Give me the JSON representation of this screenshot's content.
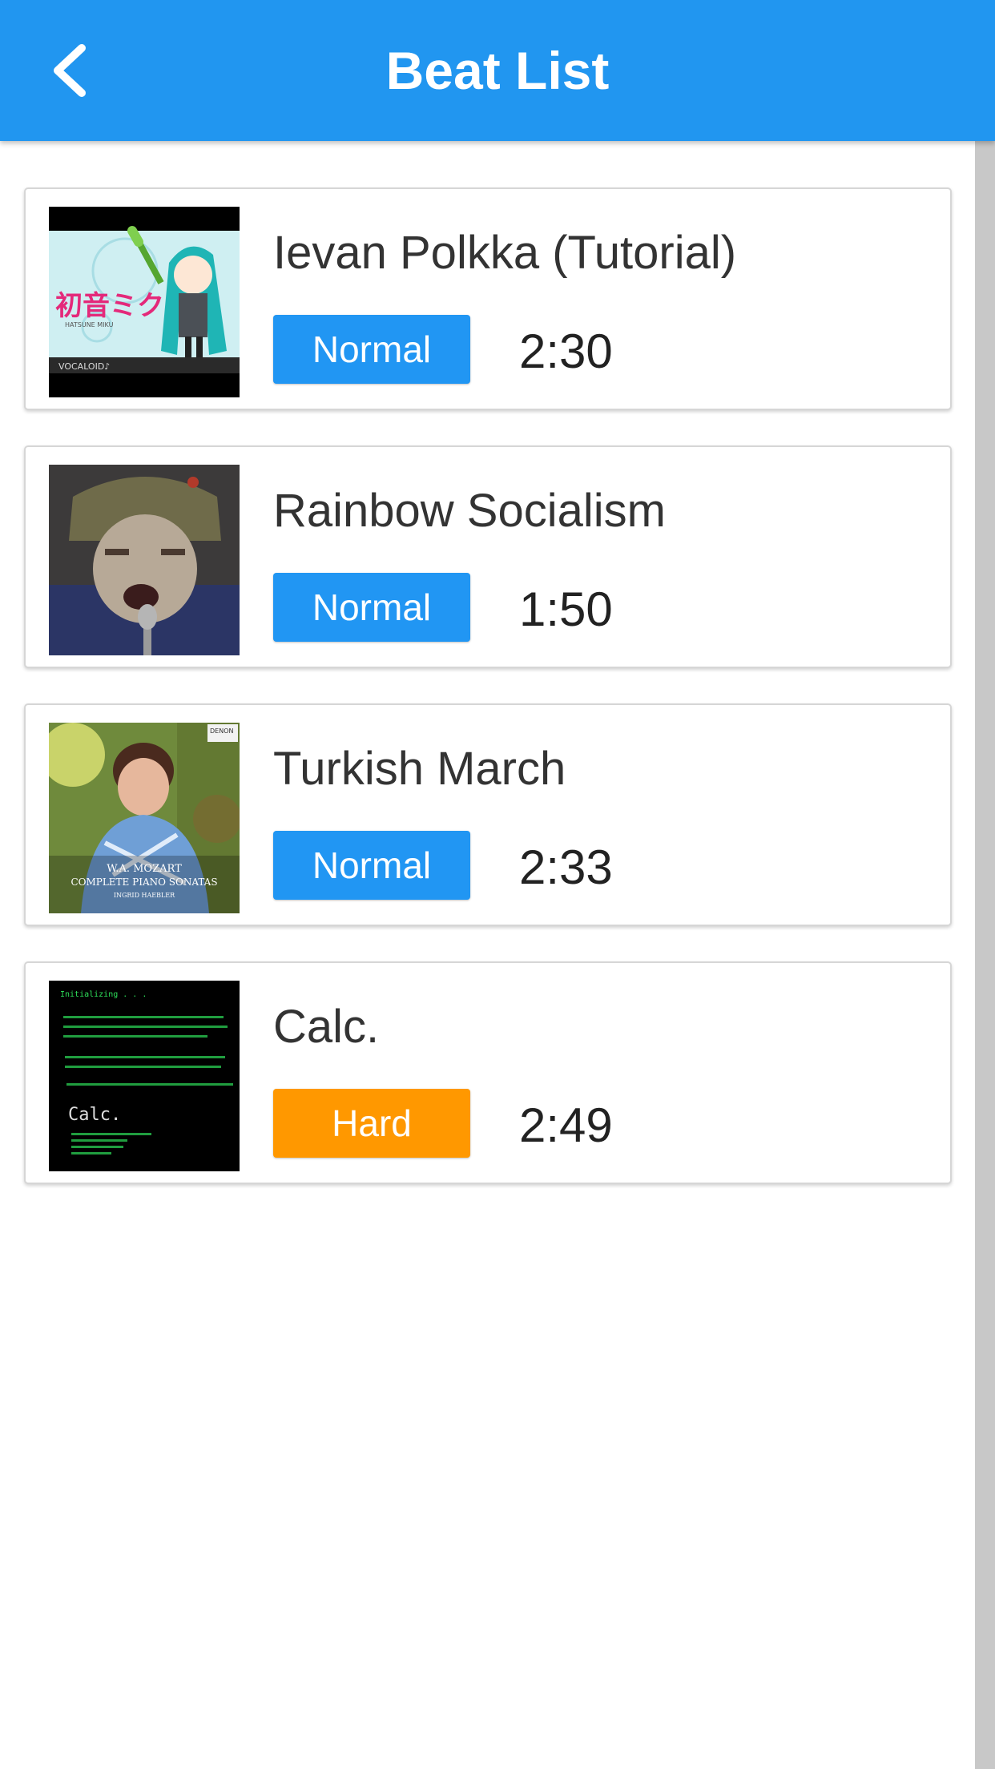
{
  "header": {
    "title": "Beat List",
    "back_icon": "chevron-left-icon",
    "background": "#2196f0"
  },
  "difficulty_colors": {
    "Normal": "#2196f3",
    "Hard": "#ff9800"
  },
  "songs": [
    {
      "title": "Ievan Polkka (Tutorial)",
      "difficulty": "Normal",
      "duration": "2:30",
      "thumbnail_text": {
        "logo": "初音ミク",
        "sub": "HATSUNE MIKU",
        "footer": "VOCALOID♪"
      }
    },
    {
      "title": "Rainbow Socialism",
      "difficulty": "Normal",
      "duration": "1:50"
    },
    {
      "title": "Turkish March",
      "difficulty": "Normal",
      "duration": "2:33",
      "thumbnail_text": {
        "label": "DENON",
        "line1": "W.A. MOZART",
        "line2": "COMPLETE PIANO SONATAS",
        "line3": "INGRID HAEBLER"
      }
    },
    {
      "title": "Calc.",
      "difficulty": "Hard",
      "duration": "2:49",
      "thumbnail_text": {
        "line1": "Initializing . . .",
        "label": "Calc."
      }
    }
  ]
}
